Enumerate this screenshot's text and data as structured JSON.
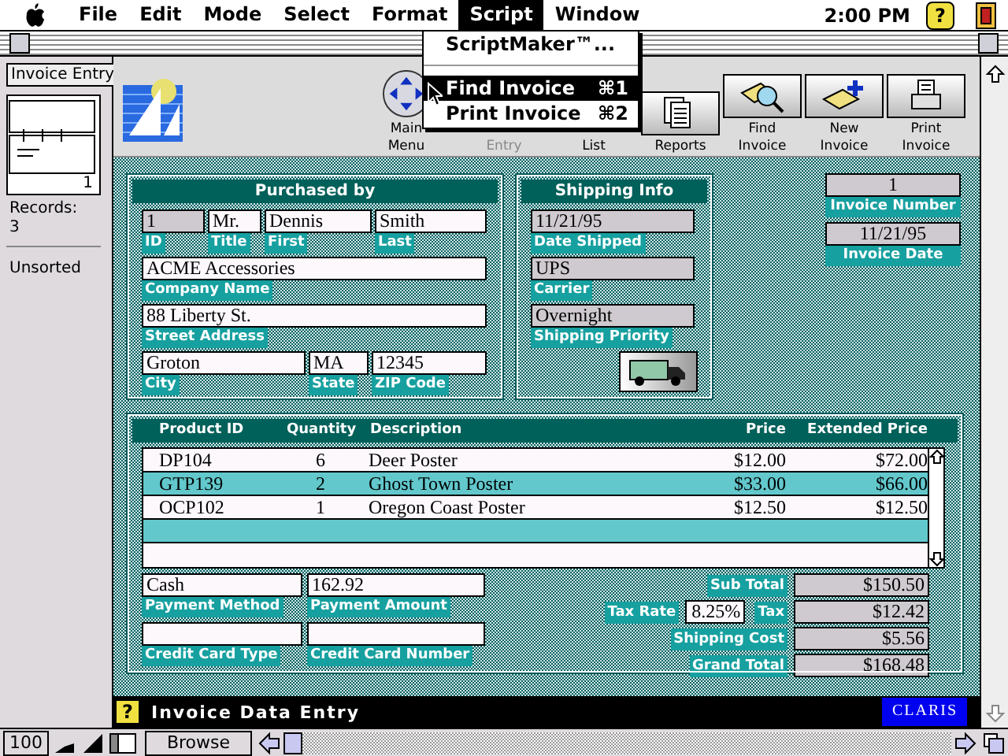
{
  "menu_bar": {
    "items": [
      {
        "label": "File",
        "selected": false
      },
      {
        "label": "Edit",
        "selected": false
      },
      {
        "label": "Mode",
        "selected": false
      },
      {
        "label": "Select",
        "selected": false
      },
      {
        "label": "Format",
        "selected": false
      },
      {
        "label": "Script",
        "selected": true
      },
      {
        "label": "Window",
        "selected": false
      }
    ],
    "clock": "2:00 PM",
    "help": "?"
  },
  "script_menu": {
    "items": [
      {
        "kind": "item",
        "label": "ScriptMaker™...",
        "selected": false
      },
      {
        "kind": "separator"
      },
      {
        "kind": "item",
        "label": "Find Invoice",
        "shortcut": "⌘1",
        "selected": true
      },
      {
        "kind": "item",
        "label": "Print Invoice",
        "shortcut": "⌘2",
        "selected": false
      }
    ]
  },
  "sidebar": {
    "layout": "Invoice Entry",
    "record": "1",
    "records_label": "Records:",
    "records_count": "3",
    "sort_status": "Unsorted"
  },
  "toolbar": [
    {
      "kind": "main",
      "lines": [
        "Main",
        "Menu"
      ],
      "disabled": false
    },
    {
      "kind": "entry",
      "lines": [
        "Entry"
      ],
      "disabled": true
    },
    {
      "kind": "list",
      "lines": [
        "List"
      ],
      "disabled": false
    },
    {
      "kind": "reports",
      "lines": [
        "Reports"
      ],
      "disabled": false
    },
    {
      "kind": "find",
      "lines": [
        "Find",
        "Invoice"
      ],
      "disabled": false
    },
    {
      "kind": "new",
      "lines": [
        "New",
        "Invoice"
      ],
      "disabled": false
    },
    {
      "kind": "print",
      "lines": [
        "Print",
        "Invoice"
      ],
      "disabled": false
    }
  ],
  "purchased_by": {
    "title": "Purchased by",
    "lines": [
      {
        "fields": [
          {
            "label": "ID",
            "value": "1",
            "locked": true
          },
          {
            "label": "Title",
            "value": "Mr.",
            "locked": false
          },
          {
            "label": "First",
            "value": "Dennis",
            "locked": false
          },
          {
            "label": "Last",
            "value": "Smith",
            "locked": false
          }
        ]
      },
      {
        "fields": [
          {
            "label": "Company Name",
            "value": "ACME Accessories",
            "locked": false
          }
        ]
      },
      {
        "fields": [
          {
            "label": "Street Address",
            "value": "88 Liberty St.",
            "locked": false
          }
        ]
      },
      {
        "fields": [
          {
            "label": "City",
            "value": "Groton",
            "locked": false
          },
          {
            "label": "State",
            "value": "MA",
            "locked": false
          },
          {
            "label": "ZIP Code",
            "value": "12345",
            "locked": false
          }
        ]
      }
    ]
  },
  "shipping_info": {
    "title": "Shipping Info",
    "fields": [
      {
        "label": "Date Shipped",
        "value": "11/21/95",
        "locked": true
      },
      {
        "label": "Carrier",
        "value": "UPS",
        "locked": true
      },
      {
        "label": "Shipping Priority",
        "value": "Overnight",
        "locked": true
      }
    ]
  },
  "invoice": [
    {
      "label": "Invoice Number",
      "value": "1"
    },
    {
      "label": "Invoice Date",
      "value": "11/21/95"
    }
  ],
  "line_items": {
    "columns": [
      "Product ID",
      "Quantity",
      "Description",
      "Price",
      "Extended Price"
    ],
    "rows": [
      [
        "DP104",
        "6",
        "Deer Poster",
        "$12.00",
        "$72.00"
      ],
      [
        "GTP139",
        "2",
        "Ghost Town Poster",
        "$33.00",
        "$66.00"
      ],
      [
        "OCP102",
        "1",
        "Oregon Coast Poster",
        "$12.50",
        "$12.50"
      ]
    ]
  },
  "payment": [
    [
      {
        "label": "Payment Method",
        "value": "Cash"
      },
      {
        "label": "Payment Amount",
        "value": "162.92"
      }
    ],
    [
      {
        "label": "Credit Card Type"
      },
      {
        "label": "Credit Card Number"
      }
    ]
  ],
  "totals": [
    {
      "label": "Sub Total",
      "value": "$150.50"
    },
    {
      "label": "Tax",
      "value": "$12.42",
      "rate": {
        "label": "Tax Rate",
        "value": "8.25%"
      }
    },
    {
      "label": "Shipping Cost",
      "value": "$5.56"
    },
    {
      "label": "Grand Total",
      "value": "$168.48"
    }
  ],
  "footer": {
    "help": "?",
    "title": "Invoice Data Entry",
    "logo": "CLARIS"
  },
  "status_bar": {
    "zoom": "100",
    "mode": "Browse"
  }
}
